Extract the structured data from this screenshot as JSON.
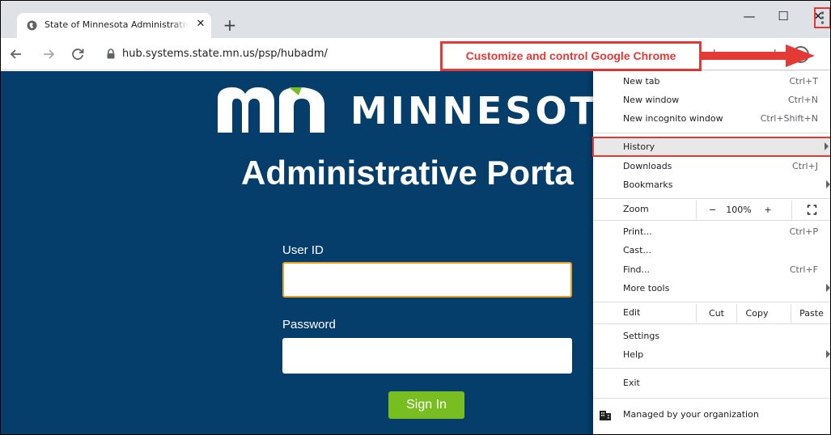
{
  "browser": {
    "tab_title": "State of Minnesota Administrative Portal",
    "tab_close": "✕",
    "new_tab": "+",
    "window_minimize": "—",
    "window_maximize": "☐",
    "window_close": "✕",
    "url": "hub.systems.state.mn.us/psp/hubadm/",
    "toolbar_partial_1": "L",
    "toolbar_partial_2": "J"
  },
  "callout": {
    "text": "Customize and control Google Chrome"
  },
  "page": {
    "logo_word": "MINNESOT",
    "portal_title": "Administrative Porta",
    "user_id_label": "User ID",
    "user_id_value": "",
    "password_label": "Password",
    "password_value": "",
    "signin_label": "Sign In"
  },
  "menu": {
    "new_tab": {
      "label": "New tab",
      "shortcut": "Ctrl+T"
    },
    "new_window": {
      "label": "New window",
      "shortcut": "Ctrl+N"
    },
    "new_incognito": {
      "label": "New incognito window",
      "shortcut": "Ctrl+Shift+N"
    },
    "history": {
      "label": "History"
    },
    "downloads": {
      "label": "Downloads",
      "shortcut": "Ctrl+J"
    },
    "bookmarks": {
      "label": "Bookmarks"
    },
    "zoom": {
      "label": "Zoom",
      "minus": "−",
      "level": "100%",
      "plus": "+"
    },
    "print": {
      "label": "Print...",
      "shortcut": "Ctrl+P"
    },
    "cast": {
      "label": "Cast..."
    },
    "find": {
      "label": "Find...",
      "shortcut": "Ctrl+F"
    },
    "more_tools": {
      "label": "More tools"
    },
    "edit": {
      "label": "Edit",
      "cut": "Cut",
      "copy": "Copy",
      "paste": "Paste"
    },
    "settings": {
      "label": "Settings"
    },
    "help": {
      "label": "Help"
    },
    "exit": {
      "label": "Exit"
    },
    "managed": {
      "label": "Managed by your organization"
    }
  },
  "colors": {
    "page_bg": "#053d6b",
    "accent_red": "#e53935",
    "signin_green": "#78be20",
    "focus_orange": "#f29d1f"
  },
  "icons": [
    "globe-icon",
    "back-arrow-icon",
    "forward-arrow-icon",
    "reload-icon",
    "lock-icon",
    "profile-icon",
    "kebab-menu-icon",
    "fullscreen-icon",
    "building-icon",
    "submenu-arrow-icon"
  ]
}
